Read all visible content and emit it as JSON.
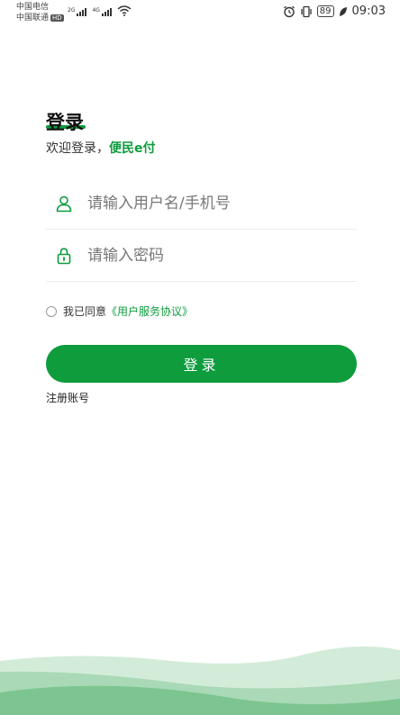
{
  "status_bar": {
    "carrier_1": "中国电信",
    "carrier_2": "中国联通",
    "hd_badge": "HD",
    "net_1": "2G",
    "net_2": "4G",
    "battery": "89",
    "time": "09:03"
  },
  "login": {
    "title": "登录",
    "welcome_prefix": "欢迎登录，",
    "brand": "便民e付",
    "username_placeholder": "请输入用户名/手机号",
    "password_placeholder": "请输入密码",
    "agree_prefix": "我已同意",
    "agreement_link": "《用户服务协议》",
    "login_button": "登录",
    "register_link": "注册账号"
  },
  "colors": {
    "accent": "#0e9c3d",
    "wave_light": "#d3ecd9",
    "wave_mid": "#a9d9b6",
    "wave_dark": "#7cc590"
  },
  "icons": {
    "username": "user-icon",
    "password": "lock-icon"
  }
}
